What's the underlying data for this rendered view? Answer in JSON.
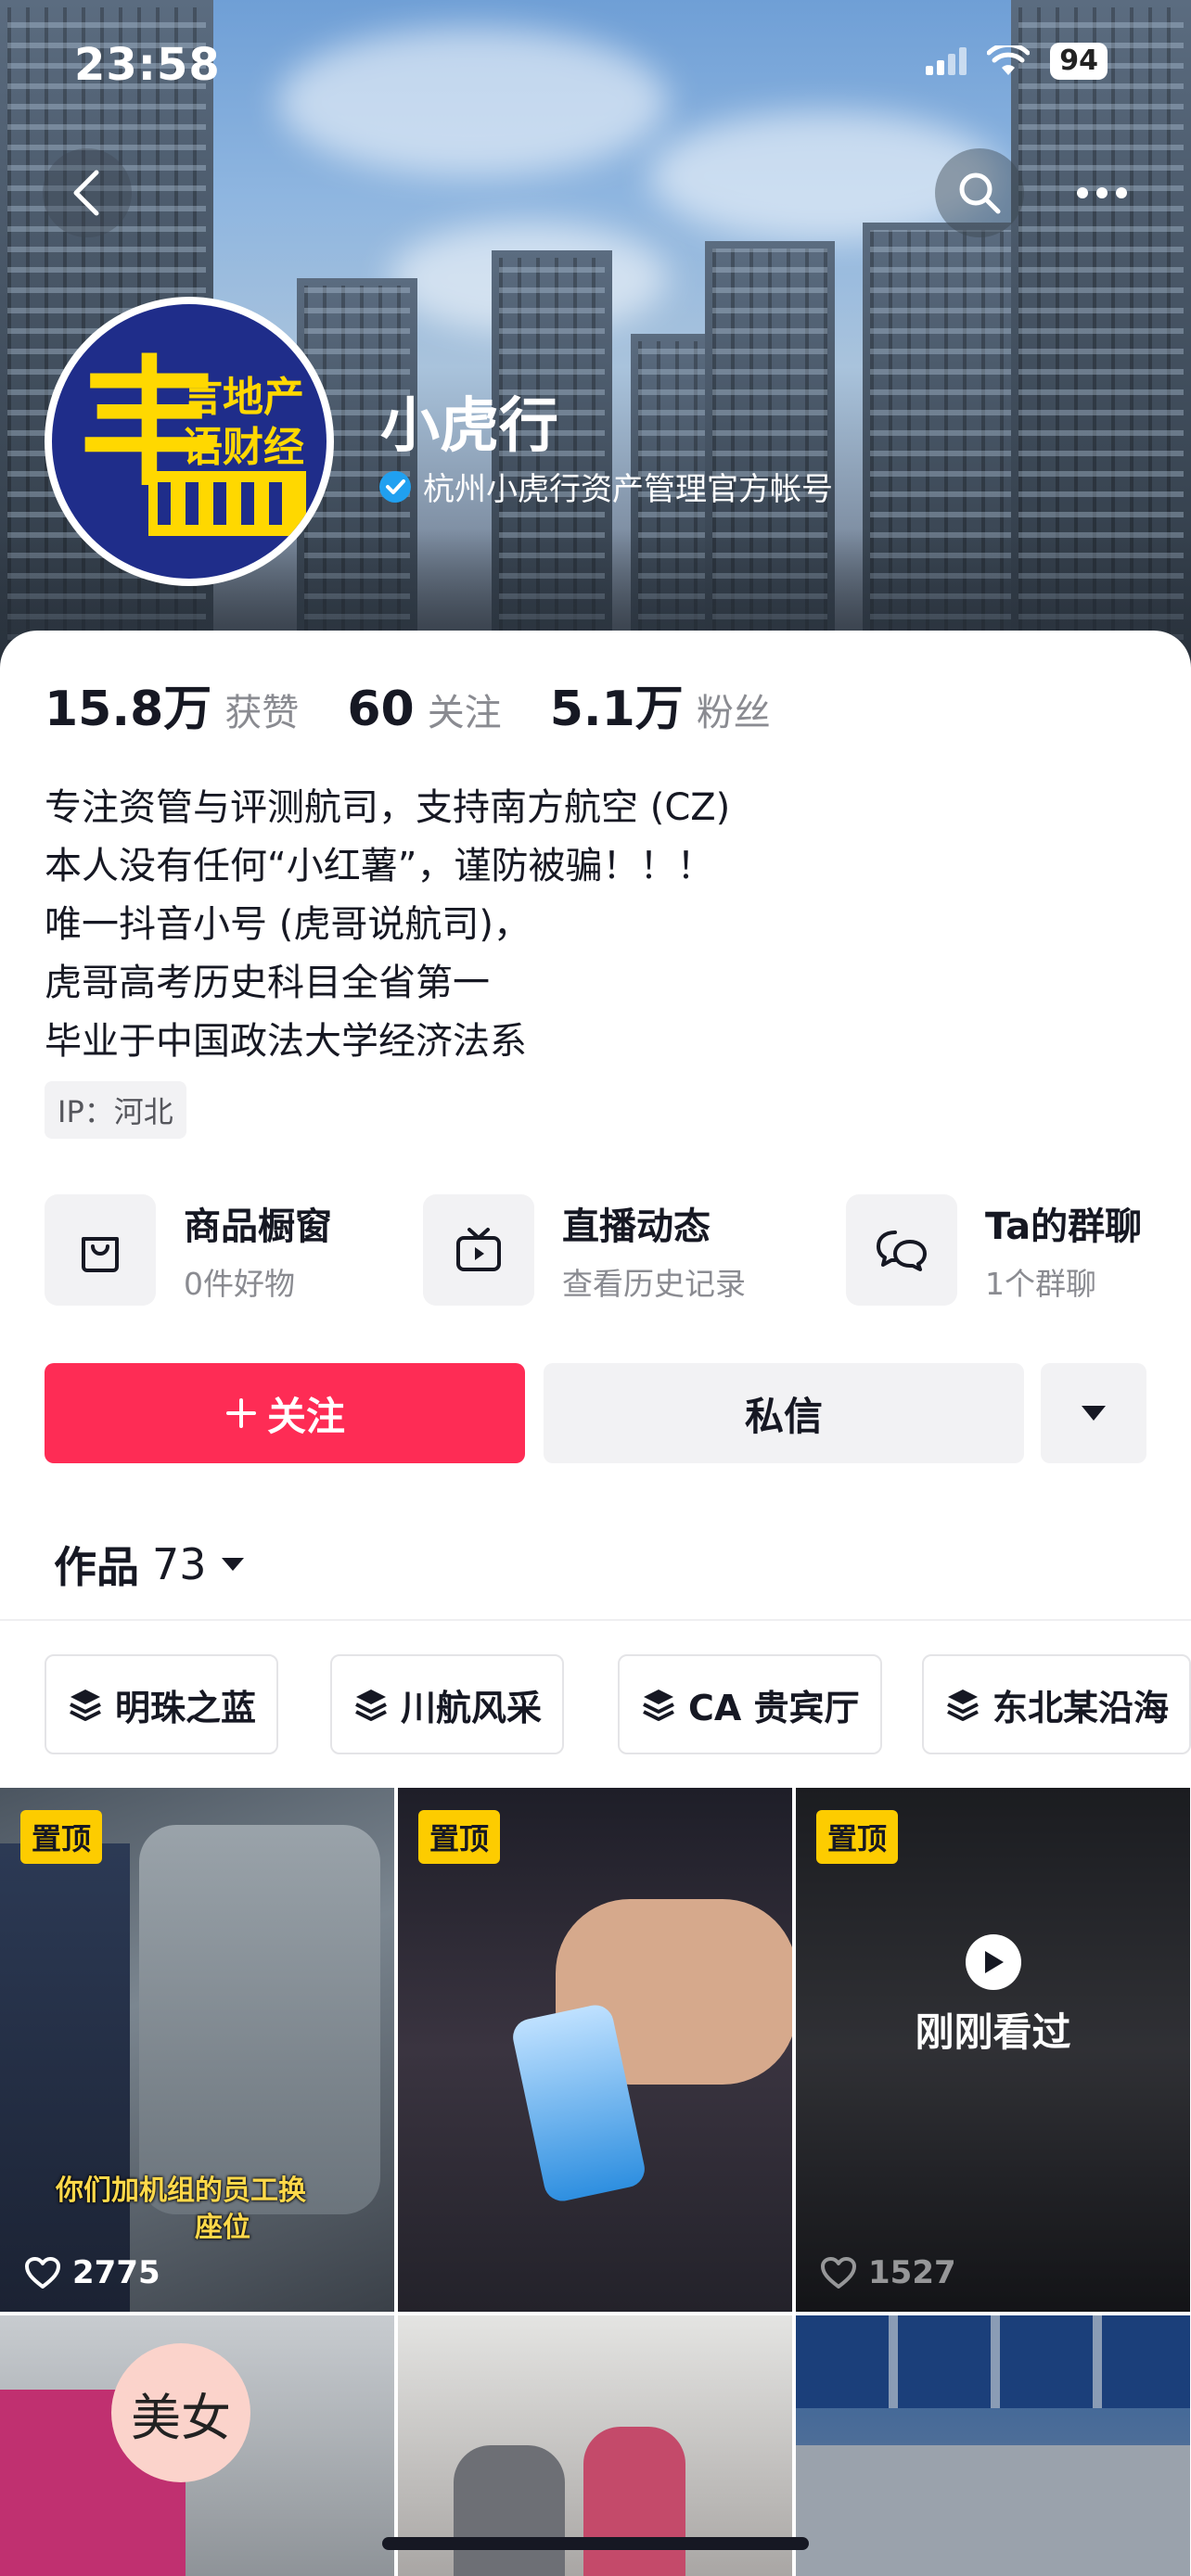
{
  "status_bar": {
    "time": "23:58",
    "battery": "94"
  },
  "profile": {
    "avatar_text_line1": "言地产",
    "avatar_text_line2": "语财经",
    "avatar_big_char": "丰",
    "nickname": "小虎行",
    "verified_label": "杭州小虎行资产管理官方帐号"
  },
  "stats": [
    {
      "num": "15.8万",
      "label": "获赞"
    },
    {
      "num": "60",
      "label": "关注"
    },
    {
      "num": "5.1万",
      "label": "粉丝"
    }
  ],
  "bio": [
    "专注资管与评测航司，支持南方航空 (CZ)",
    "本人没有任何“小红薯”，谨防被骗！！！",
    "唯一抖音小号 (虎哥说航司)，",
    "虎哥高考历史科目全省第一",
    "毕业于中国政法大学经济法系"
  ],
  "ip_tag": "IP：河北",
  "entries": [
    {
      "title": "商品橱窗",
      "sub": "0件好物",
      "icon": "shopping-bag-icon"
    },
    {
      "title": "直播动态",
      "sub": "查看历史记录",
      "icon": "tv-icon"
    },
    {
      "title": "Ta的群聊",
      "sub": "1个群聊",
      "icon": "chat-bubbles-icon"
    }
  ],
  "actions": {
    "follow_label": "关注",
    "message_label": "私信"
  },
  "works": {
    "label": "作品",
    "count": "73"
  },
  "collections": [
    "明珠之蓝",
    "川航风采",
    "CA 贵宾厅",
    "东北某沿海"
  ],
  "videos": [
    {
      "pinned_label": "置顶",
      "likes": "2775",
      "caption_line1": "你们加机组的员工换",
      "caption_line2": "座位"
    },
    {
      "pinned_label": "置顶"
    },
    {
      "pinned_label": "置顶",
      "likes": "1527",
      "watched_label": "刚刚看过"
    },
    {
      "sticker_text": "美女"
    },
    {},
    {}
  ],
  "colors": {
    "accent": "#fe2c55",
    "pin_badge": "#fdcc00",
    "verified": "#20a0f0"
  }
}
